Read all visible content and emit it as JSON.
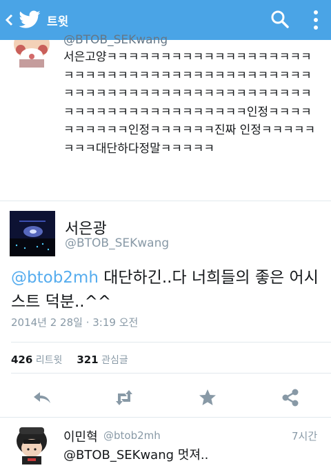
{
  "topbar": {
    "title": "트윗",
    "bg_color": "#4aa4e6"
  },
  "previous_tweet": {
    "handle": "@BTOB_SEKwang",
    "text": "서은고양ㅋㅋㅋㅋㅋㅋㅋㅋㅋㅋㅋㅋㅋㅋㅋㅋㅋㅋㅋㅋㅋㅋㅋㅋㅋㅋㅋㅋㅋㅋㅋㅋㅋㅋㅋㅋㅋㅋㅋㅋㅋㅋㅋㅋㅋㅋㅋㅋㅋㅋㅋㅋㅋㅋㅋㅋㅋㅋㅋㅋㅋㅋㅋㅋㅋㅋㅋㅋㅋㅋㅋㅋㅋㅋㅋㅋㅋㅋㅋㅋㅋㅋ인정ㅋㅋㅋㅋㅋㅋㅋㅋㅋㅋ인정ㅋㅋㅋㅋㅋㅋ진짜 인정ㅋㅋㅋㅋㅋㅋㅋㅋ대단하다정말ㅋㅋㅋㅋㅋ"
  },
  "main_tweet": {
    "name": "서은광",
    "handle": "@BTOB_SEKwang",
    "mention": "@btob2mh",
    "text": " 대단하긴..다 너희들의 좋은 어시스트 덕분..^^",
    "timestamp": "2014년 2 28일 · 3:19 오전",
    "retweet_count": "426",
    "retweet_label": "리트윗",
    "favorite_count": "321",
    "favorite_label": "관심글"
  },
  "actions": [
    "reply-icon",
    "retweet-icon",
    "favorite-icon",
    "share-icon"
  ],
  "reply_tweet": {
    "name": "이민혁",
    "handle": "@btob2mh",
    "time": "7시간",
    "text": "@BTOB_SEKwang 멋져.."
  },
  "colors": {
    "accent": "#55acee",
    "muted": "#8899a6"
  }
}
